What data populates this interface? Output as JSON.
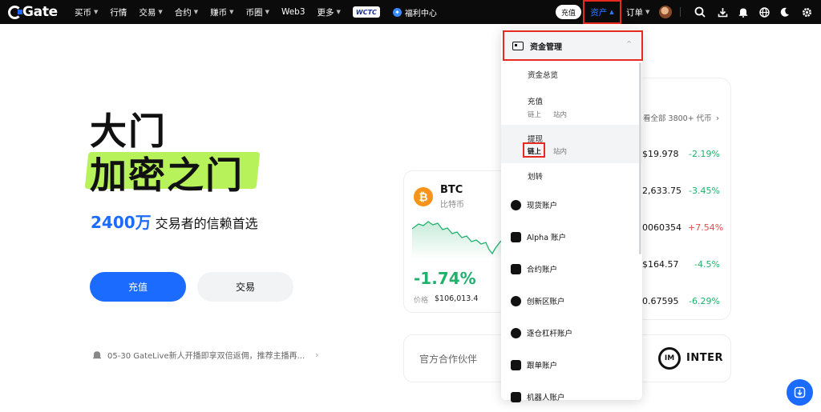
{
  "brand": {
    "name": "Gate"
  },
  "topnav": {
    "items": [
      {
        "label": "买币",
        "caret": true
      },
      {
        "label": "行情",
        "caret": false
      },
      {
        "label": "交易",
        "caret": true
      },
      {
        "label": "合约",
        "caret": true
      },
      {
        "label": "赚币",
        "caret": true
      },
      {
        "label": "币圈",
        "caret": true
      },
      {
        "label": "Web3",
        "caret": false
      },
      {
        "label": "更多",
        "caret": true
      }
    ],
    "wctc_label": "WCTC",
    "welfare_label": "福利中心",
    "deposit_label": "充值",
    "assets_label": "资产",
    "orders_label": "订单"
  },
  "hero": {
    "title_line1": "大门",
    "title_line2": "加密之门",
    "tagline_number": "2400万",
    "tagline_text": "交易者的信赖首选",
    "deposit_button": "充值",
    "trade_button": "交易",
    "announcement": "05-30 GateLive新人开播即享双倍返佣，推荐主播再..."
  },
  "btc_card": {
    "symbol": "BTC",
    "name": "比特币",
    "change": "-1.74%",
    "price_label": "价格",
    "price": "$106,013.4"
  },
  "market": {
    "view_all": "看全部 3800+ 代币",
    "rows": [
      {
        "price": "$19.978",
        "change": "-2.19%",
        "color": "#20b26c"
      },
      {
        "price": "2,633.75",
        "change": "-3.45%",
        "color": "#20b26c"
      },
      {
        "price": "0060354",
        "change": "+7.54%",
        "color": "#e84a4a"
      },
      {
        "price": "$164.57",
        "change": "-4.5%",
        "color": "#20b26c"
      },
      {
        "price": "0.67595",
        "change": "-6.29%",
        "color": "#20b26c"
      }
    ]
  },
  "partners": {
    "label": "官方合作伙伴",
    "partner_name": "INTER"
  },
  "assets_menu": {
    "header": "资金管理",
    "overview": "资金总览",
    "deposit": "充值",
    "deposit_onchain": "链上",
    "deposit_internal": "站内",
    "withdraw": "提现",
    "withdraw_onchain": "链上",
    "withdraw_internal": "站内",
    "transfer": "划转",
    "accounts": [
      {
        "label": "现货账户"
      },
      {
        "label": "Alpha 账户"
      },
      {
        "label": "合约账户"
      },
      {
        "label": "创新区账户"
      },
      {
        "label": "逐仓杠杆账户"
      },
      {
        "label": "跟单账户"
      },
      {
        "label": "机器人账户"
      }
    ]
  },
  "colors": {
    "accent": "#1c6bff",
    "up": "#20b26c",
    "down": "#e84a4a",
    "highlight": "#b7f25a",
    "annotation": "#e62a20"
  }
}
